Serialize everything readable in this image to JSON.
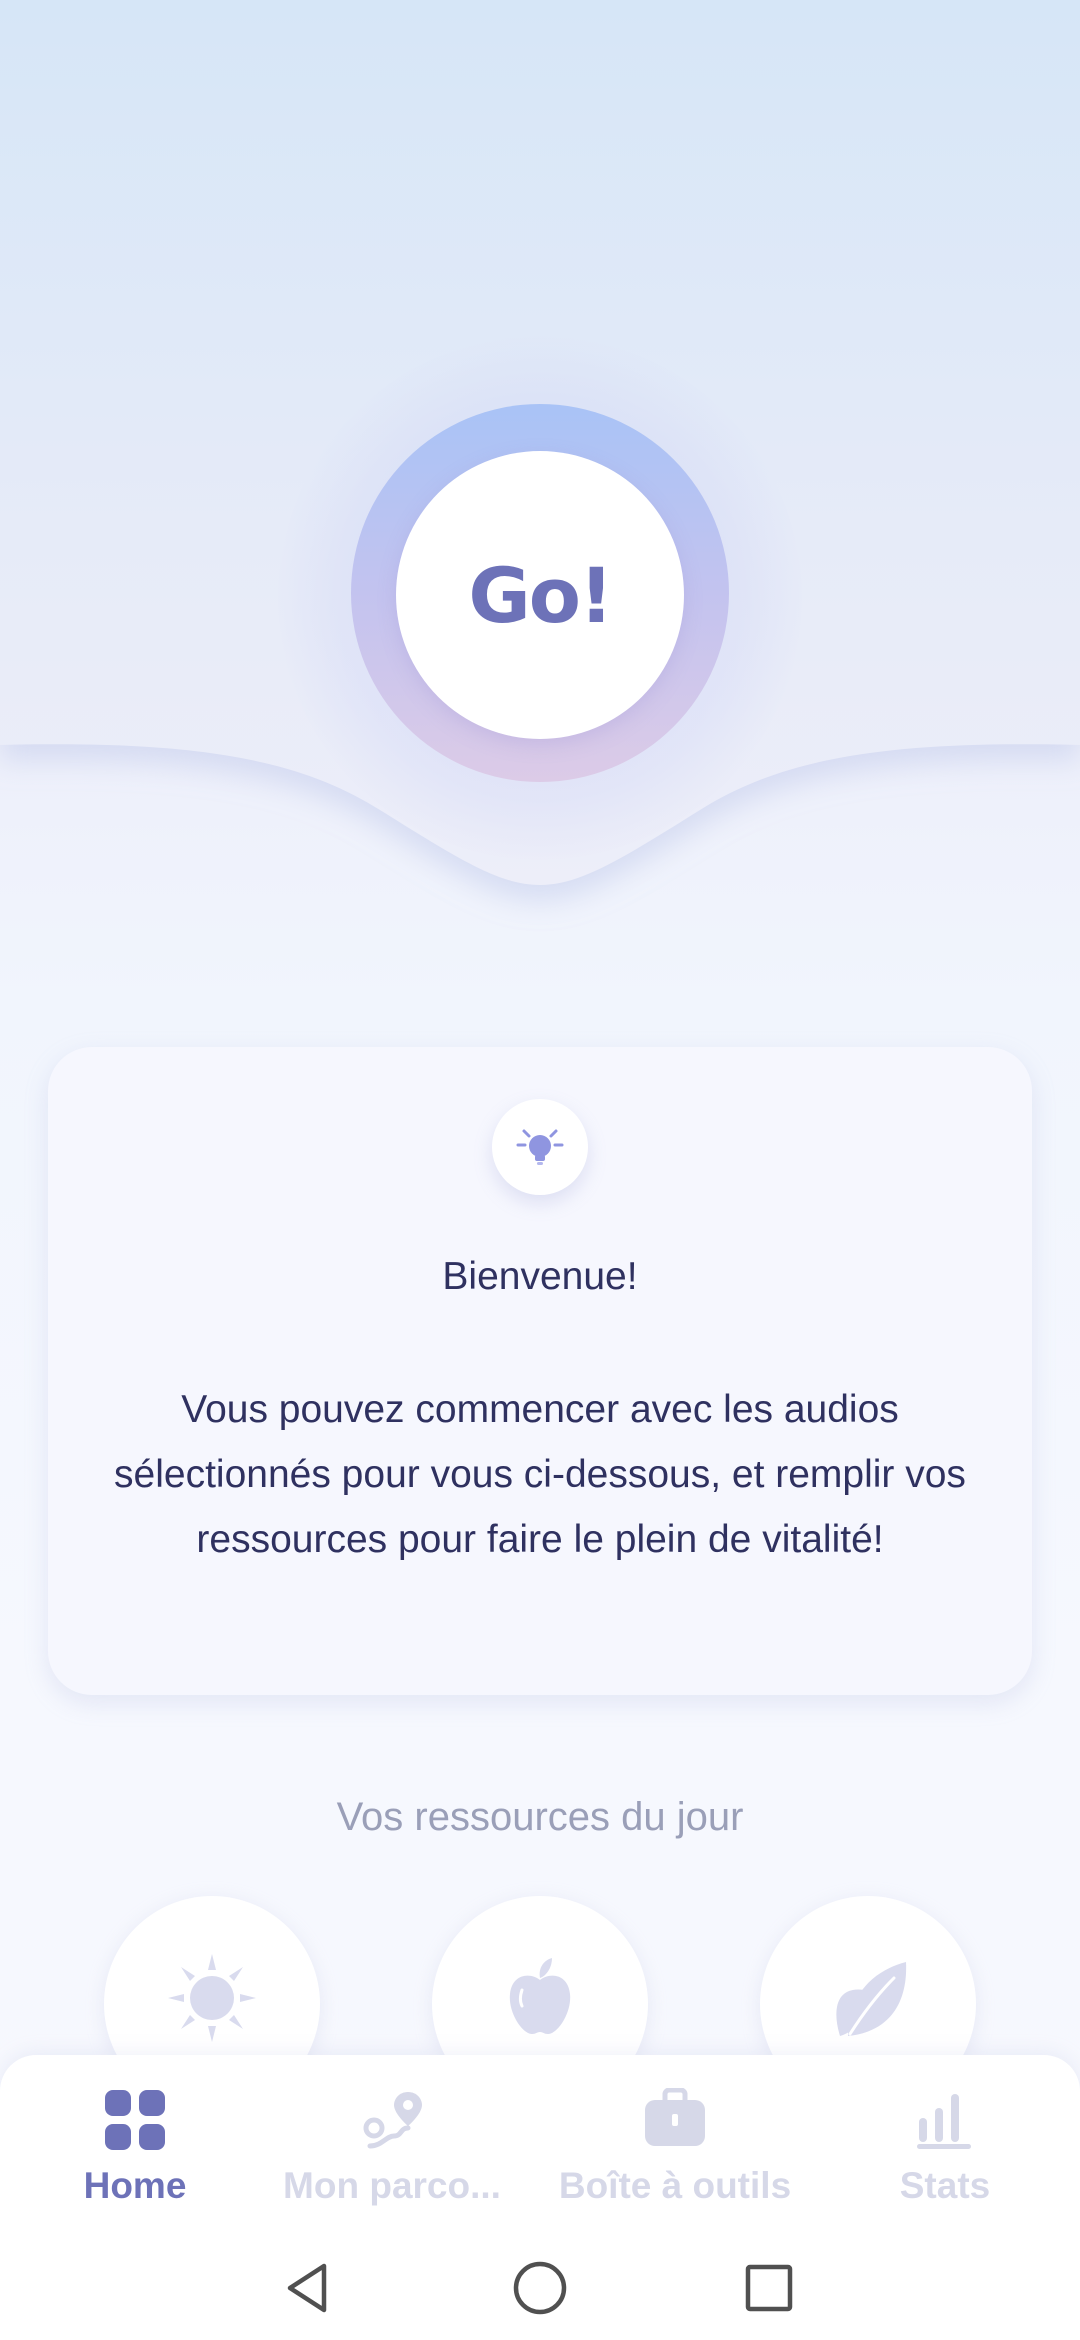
{
  "hero": {
    "go_label": "Go!"
  },
  "welcome": {
    "icon": "lightbulb-icon",
    "title": "Bienvenue!",
    "body": "Vous pouvez commencer avec les audios sélectionnés pour vous ci-dessous, et remplir vos ressources pour faire le plein de vitalité!"
  },
  "resources": {
    "title": "Vos ressources du jour",
    "items": [
      {
        "icon": "sun-icon"
      },
      {
        "icon": "apple-icon"
      },
      {
        "icon": "leaf-icon"
      }
    ]
  },
  "nav": {
    "items": [
      {
        "label": "Home",
        "icon": "grid-icon",
        "active": true
      },
      {
        "label": "Mon parco...",
        "icon": "route-icon",
        "active": false
      },
      {
        "label": "Boîte à outils",
        "icon": "toolbox-icon",
        "active": false
      },
      {
        "label": "Stats",
        "icon": "bar-chart-icon",
        "active": false
      }
    ]
  },
  "system_nav": {
    "items": [
      "back-icon",
      "home-circle-icon",
      "recents-square-icon"
    ]
  },
  "colors": {
    "accent": "#6d72b8",
    "text": "#2f3160",
    "muted": "#9a9fb8",
    "inactive": "#d6d8e8"
  }
}
